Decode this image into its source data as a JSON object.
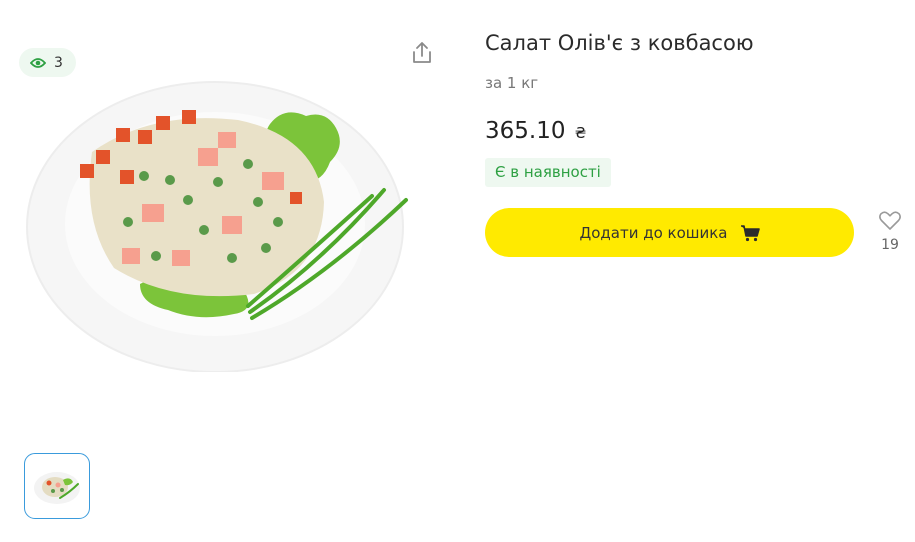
{
  "gallery": {
    "views_count": "3",
    "icons": {
      "views": "eye-icon",
      "share": "share-icon"
    },
    "thumbnail_count": 1
  },
  "product": {
    "title": "Салат Олів'є з ковбасою",
    "unit": "за 1 кг",
    "price": "365.10",
    "currency": "₴",
    "availability": "Є в наявності"
  },
  "actions": {
    "add_to_cart_label": "Додати до кошика",
    "cart_icon": "cart-icon",
    "favorite_icon": "heart-icon",
    "favorite_count": "19"
  },
  "colors": {
    "accent_yellow": "#ffea00",
    "stock_green": "#2ea043",
    "stock_bg": "#eef8f0",
    "thumb_border": "#3a9bdc"
  }
}
